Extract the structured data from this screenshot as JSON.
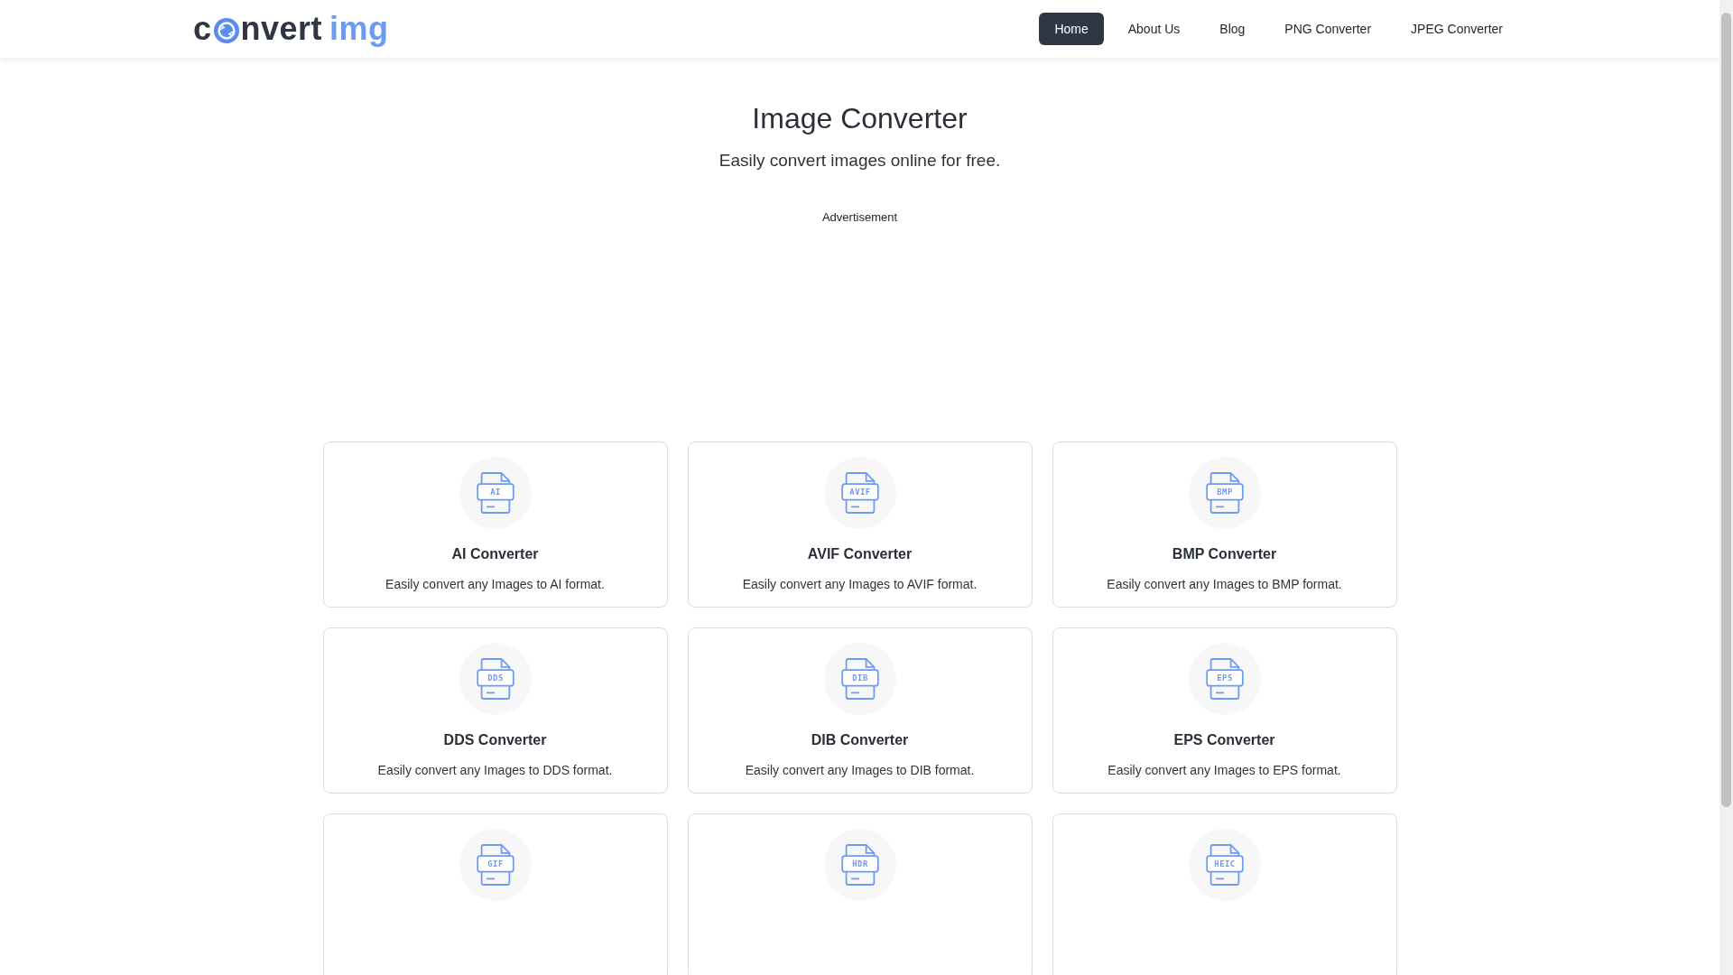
{
  "header": {
    "logo": {
      "before": "c",
      "after": "nvert",
      "accent": "img"
    },
    "nav": [
      {
        "label": "Home",
        "selected": true
      },
      {
        "label": "About Us",
        "selected": false
      },
      {
        "label": "Blog",
        "selected": false
      },
      {
        "label": "PNG Converter",
        "selected": false
      },
      {
        "label": "JPEG Converter",
        "selected": false
      }
    ]
  },
  "hero": {
    "title": "Image Converter",
    "subtitle": "Easily convert images online for free."
  },
  "ad": {
    "label": "Advertisement"
  },
  "cards": [
    {
      "icon_label": "AI",
      "title": "AI Converter",
      "description": "Easily convert any Images to AI format."
    },
    {
      "icon_label": "AVIF",
      "title": "AVIF Converter",
      "description": "Easily convert any Images to AVIF format."
    },
    {
      "icon_label": "BMP",
      "title": "BMP Converter",
      "description": "Easily convert any Images to BMP format."
    },
    {
      "icon_label": "DDS",
      "title": "DDS Converter",
      "description": "Easily convert any Images to DDS format."
    },
    {
      "icon_label": "DIB",
      "title": "DIB Converter",
      "description": "Easily convert any Images to DIB format."
    },
    {
      "icon_label": "EPS",
      "title": "EPS Converter",
      "description": "Easily convert any Images to EPS format."
    },
    {
      "icon_label": "GIF"
    },
    {
      "icon_label": "HDR"
    },
    {
      "icon_label": "HEIC"
    }
  ]
}
